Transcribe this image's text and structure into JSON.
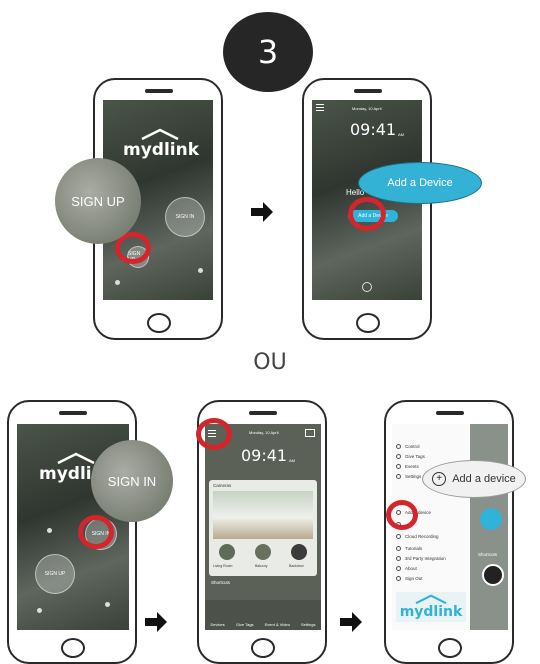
{
  "step": {
    "number": "3"
  },
  "separator": {
    "text": "OU"
  },
  "brand": {
    "logo_text": "mydlink"
  },
  "phone1": {
    "sign_up_bubble": "SIGN UP",
    "sign_in_small": "SIGN IN",
    "sign_up_small": "SIGN UP"
  },
  "phone2": {
    "date": "Monday, 10 April",
    "time": "09:41",
    "ampm": "AM",
    "hello": "Hello",
    "add_device_pill": "Add a Device",
    "add_device_callout": "Add a Device"
  },
  "phone3": {
    "sign_in_bubble": "SIGN IN",
    "sign_in_small": "SIGN IN",
    "sign_up_small": "SIGN UP"
  },
  "phone4": {
    "date": "Monday, 10 April",
    "time": "09:41",
    "ampm": "AM",
    "cameras_label": "Cameras",
    "rooms": [
      "Living Room",
      "Balcony",
      "Backdoor"
    ],
    "shortcuts_label": "Shortcuts",
    "tabs": [
      "Devices",
      "Give Tags",
      "Event & Video",
      "Settings"
    ]
  },
  "phone5": {
    "menu_items": [
      "Control",
      "Give Tags",
      "Events",
      "Settings",
      "Add a device",
      "",
      "Cloud Recording",
      "Tutorials",
      "3rd Party Integration",
      "About",
      "Sign Out"
    ],
    "callout": "Add a device",
    "shortcuts_label": "Shortcuts"
  },
  "colors": {
    "red_ring": "#d4252c",
    "accent_blue": "#2fb3d9",
    "phone_outline": "#2a2a2a"
  }
}
